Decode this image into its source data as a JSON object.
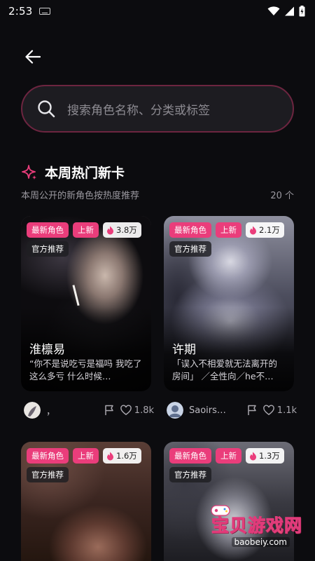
{
  "status_bar": {
    "time": "2:53"
  },
  "search": {
    "placeholder": "搜索角色名称、分类或标签"
  },
  "section": {
    "title": "本周热门新卡",
    "subtitle": "本周公开的新角色按热度推荐",
    "count": "20 个"
  },
  "cards": [
    {
      "badge_new_role": "最新角色",
      "badge_new": "上新",
      "heat": "3.8万",
      "badge_official": "官方推荐",
      "name": "淮檩易",
      "desc": "“你不是说吃亏是福吗 我吃了这么多亏 什么时候…",
      "author": "，",
      "likes": "1.8k"
    },
    {
      "badge_new_role": "最新角色",
      "badge_new": "上新",
      "heat": "2.1万",
      "badge_official": "官方推荐",
      "name": "许期",
      "desc": "「误入不相爱就无法离开的房间」 ／全性向／he不…",
      "author": "Saoirs…",
      "likes": "1.1k"
    },
    {
      "badge_new_role": "最新角色",
      "badge_new": "上新",
      "heat": "1.6万",
      "badge_official": "官方推荐"
    },
    {
      "badge_new_role": "最新角色",
      "badge_new": "上新",
      "heat": "1.3万",
      "badge_official": "官方推荐"
    }
  ],
  "watermark": {
    "title": "宝贝游戏网",
    "url": "baobeiy.com"
  },
  "colors": {
    "accent": "#ea3d7b",
    "background": "#0c0c0f",
    "search_border": "#6d2540"
  }
}
